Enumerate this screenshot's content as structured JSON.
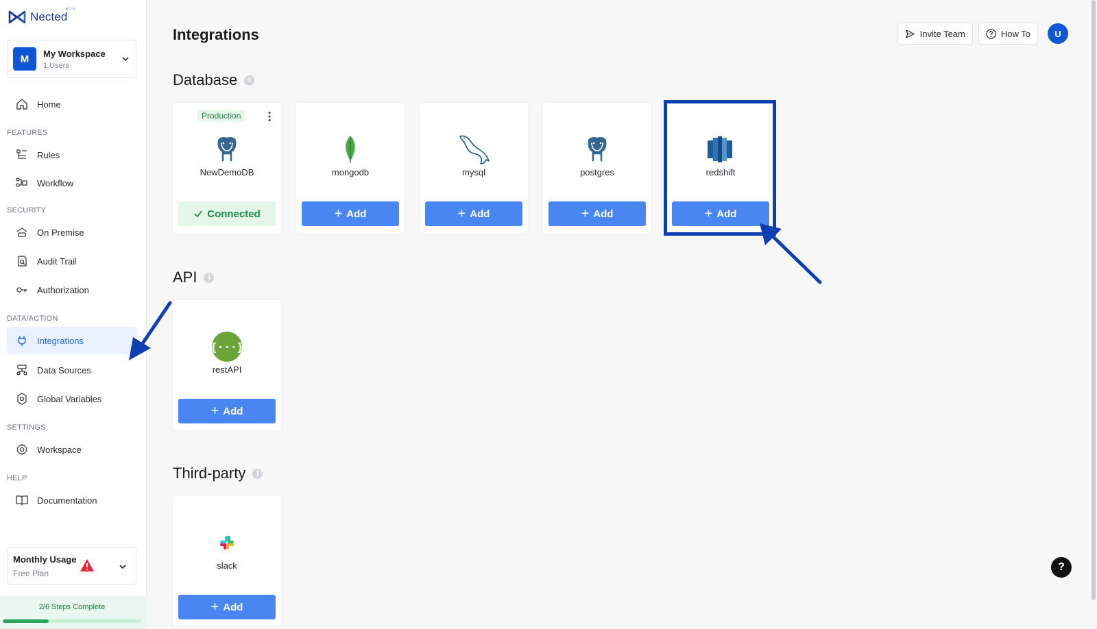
{
  "brand": {
    "name": "Nected",
    "badge": "BETA"
  },
  "workspace": {
    "avatar_letter": "M",
    "name": "My Workspace",
    "users": "1 Users"
  },
  "nav": {
    "home": "Home",
    "sections": {
      "features": "FEATURES",
      "security": "SECURITY",
      "data_action": "DATA/ACTION",
      "settings": "SETTINGS",
      "help": "HELP"
    },
    "items": {
      "rules": "Rules",
      "workflow": "Workflow",
      "on_premise": "On Premise",
      "audit_trail": "Audit Trail",
      "authorization": "Authorization",
      "integrations": "Integrations",
      "data_sources": "Data Sources",
      "global_variables": "Global Variables",
      "workspace": "Workspace",
      "documentation": "Documentation"
    },
    "active": "integrations"
  },
  "usage": {
    "title": "Monthly Usage",
    "plan": "Free Plan"
  },
  "steps": {
    "label": "2/6 Steps Complete",
    "completed": 2,
    "total": 6
  },
  "header": {
    "title": "Integrations",
    "invite_label": "Invite Team",
    "howto_label": "How To",
    "user_initial": "U"
  },
  "sections": {
    "database": {
      "title": "Database",
      "cards": [
        {
          "name": "NewDemoDB",
          "badge": "Production",
          "status": "Connected",
          "icon": "postgres-elephant-icon"
        },
        {
          "name": "mongodb",
          "action": "Add",
          "icon": "mongodb-leaf-icon"
        },
        {
          "name": "mysql",
          "action": "Add",
          "icon": "mysql-dolphin-icon"
        },
        {
          "name": "postgres",
          "action": "Add",
          "icon": "postgres-elephant-icon"
        },
        {
          "name": "redshift",
          "action": "Add",
          "icon": "redshift-icon"
        }
      ]
    },
    "api": {
      "title": "API",
      "cards": [
        {
          "name": "restAPI",
          "action": "Add",
          "icon": "rest-api-icon"
        }
      ]
    },
    "third_party": {
      "title": "Third-party",
      "cards": [
        {
          "name": "slack",
          "action": "Add",
          "icon": "slack-icon"
        }
      ]
    }
  },
  "help_fab": "?",
  "colors": {
    "primary": "#4a86f2",
    "brand_blue": "#0d56d6",
    "annotation_blue": "#0d3fb3",
    "success_green": "#1d8a47",
    "warning_red": "#e5263b"
  }
}
